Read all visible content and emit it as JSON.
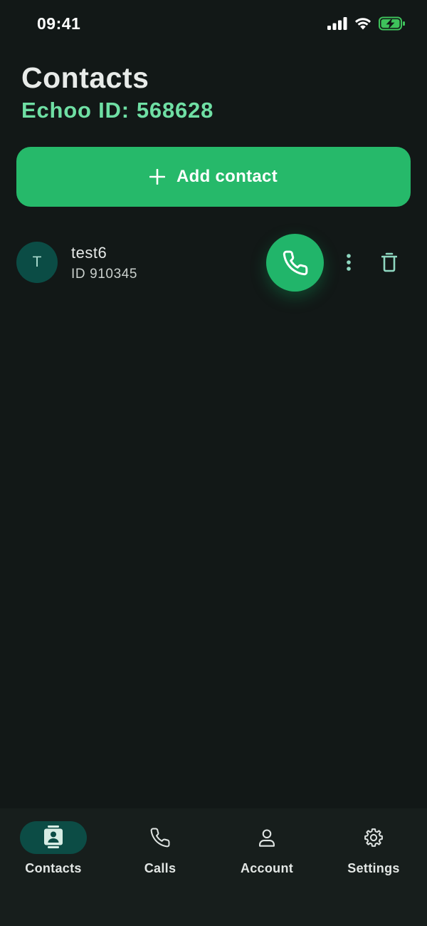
{
  "status_bar": {
    "time": "09:41"
  },
  "header": {
    "title": "Contacts",
    "id_label": "Echoo ID:",
    "id_value": "568628"
  },
  "add_contact": {
    "label": "Add contact",
    "icon": "plus-icon"
  },
  "contacts": [
    {
      "initial": "T",
      "name": "test6",
      "id_text": "ID 910345",
      "actions": [
        "phone-icon",
        "more-vertical-icon",
        "trash-icon"
      ]
    }
  ],
  "bottom_nav": {
    "items": [
      {
        "label": "Contacts",
        "icon": "contact-card-icon",
        "active": true
      },
      {
        "label": "Calls",
        "icon": "phone-icon",
        "active": false
      },
      {
        "label": "Account",
        "icon": "person-icon",
        "active": false
      },
      {
        "label": "Settings",
        "icon": "gear-icon",
        "active": false
      }
    ]
  },
  "colors": {
    "background": "#121817",
    "accent": "#26b96a",
    "accent_text": "#6fdfa4",
    "nav_background": "#171e1c",
    "avatar_background": "#0b4c45"
  }
}
